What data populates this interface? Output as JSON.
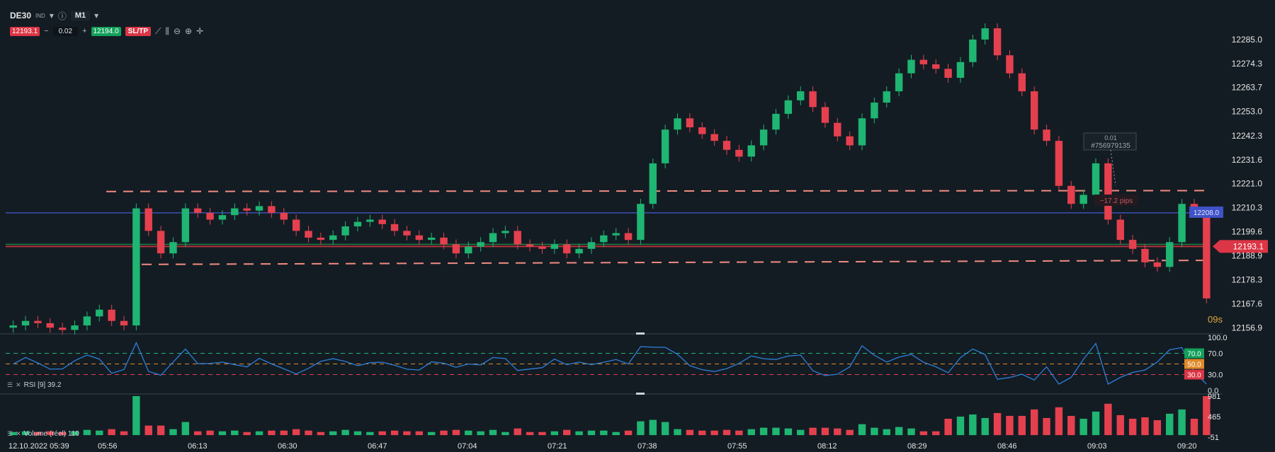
{
  "symbol": "DE30",
  "symbol_type": "IND",
  "timeframe": "M1",
  "bid": "12193.1",
  "ask": "12194.0",
  "volume_lots": "0.02",
  "minus": "−",
  "plus": "+",
  "sltp_label": "SL/TP",
  "price_axis": [
    "12285.0",
    "12274.3",
    "12263.7",
    "12253.0",
    "12242.3",
    "12231.6",
    "12221.0",
    "12210.3",
    "12199.6",
    "12188.9",
    "12178.3",
    "12167.6",
    "12156.9"
  ],
  "current_price_tag": "12193.1",
  "blue_line_tag": "12208.0",
  "countdown": "09s",
  "trade_label": {
    "value": "0.01",
    "ticket": "#756979135"
  },
  "pips_label": "−17.2 pips",
  "rsi": {
    "label": "RSI [9] 39.2",
    "levels": [
      "100.0",
      "70.0",
      "30.0",
      "0.0"
    ],
    "tags": [
      "70.0",
      "50.0",
      "30.0"
    ]
  },
  "volume": {
    "label": "Volume (réel) 110",
    "axis": [
      "981",
      "465",
      "-51"
    ]
  },
  "time_axis": [
    "12.10.2022 05:39",
    "05:56",
    "06:13",
    "06:30",
    "06:47",
    "07:04",
    "07:21",
    "07:38",
    "07:55",
    "08:12",
    "08:29",
    "08:46",
    "09:03",
    "09:20"
  ],
  "chart_data": {
    "type": "candlestick",
    "ylim": [
      12156.9,
      12290.0
    ],
    "ohlc_close": [
      12158,
      12160,
      12159,
      12157,
      12156,
      12158,
      12162,
      12165,
      12160,
      12158,
      12210,
      12200,
      12190,
      12195,
      12210,
      12208,
      12205,
      12207,
      12210,
      12209,
      12211,
      12208,
      12205,
      12200,
      12197,
      12196,
      12198,
      12202,
      12204,
      12205,
      12203,
      12200,
      12198,
      12196,
      12197,
      12194,
      12190,
      12193,
      12195,
      12199,
      12200,
      12194,
      12193,
      12192,
      12194,
      12190,
      12192,
      12195,
      12198,
      12199,
      12196,
      12212,
      12230,
      12245,
      12250,
      12246,
      12243,
      12240,
      12236,
      12233,
      12238,
      12245,
      12252,
      12258,
      12262,
      12255,
      12248,
      12242,
      12238,
      12250,
      12257,
      12262,
      12270,
      12276,
      12274,
      12272,
      12268,
      12275,
      12285,
      12290,
      12278,
      12270,
      12262,
      12245,
      12240,
      12220,
      12212,
      12216,
      12230,
      12205,
      12196,
      12192,
      12186,
      12184,
      12195,
      12212,
      12208,
      12170
    ]
  },
  "support_resistance": {
    "upper_left": 12217.5,
    "upper_right": 12217.9,
    "lower_left": 12185.1,
    "lower_right": 12186.9,
    "blue": 12208.0
  }
}
